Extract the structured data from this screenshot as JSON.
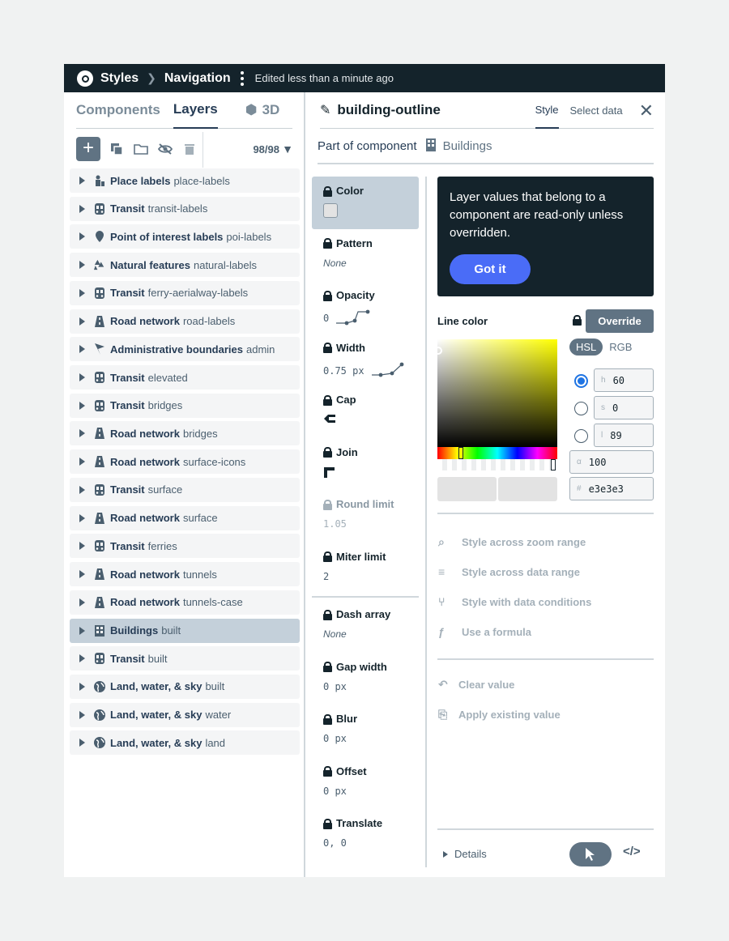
{
  "header": {
    "breadcrumb": [
      "Styles",
      "Navigation"
    ],
    "edited": "Edited less than a minute ago"
  },
  "left_panel": {
    "tabs": [
      "Components",
      "Layers",
      "3D"
    ],
    "layer_count": "98/98",
    "layers": [
      {
        "name": "Place labels",
        "id": "place-labels",
        "icon": "person-icon"
      },
      {
        "name": "Transit",
        "id": "transit-labels",
        "icon": "train-icon"
      },
      {
        "name": "Point of interest labels",
        "id": "poi-labels",
        "icon": "pin-icon"
      },
      {
        "name": "Natural features",
        "id": "natural-labels",
        "icon": "tree-icon"
      },
      {
        "name": "Transit",
        "id": "ferry-aerialway-labels",
        "icon": "train-icon"
      },
      {
        "name": "Road network",
        "id": "road-labels",
        "icon": "road-icon"
      },
      {
        "name": "Administrative boundaries",
        "id": "admin",
        "icon": "flag-icon"
      },
      {
        "name": "Transit",
        "id": "elevated",
        "icon": "train-icon"
      },
      {
        "name": "Transit",
        "id": "bridges",
        "icon": "train-icon"
      },
      {
        "name": "Road network",
        "id": "bridges",
        "icon": "road-icon"
      },
      {
        "name": "Road network",
        "id": "surface-icons",
        "icon": "road-icon"
      },
      {
        "name": "Transit",
        "id": "surface",
        "icon": "train-icon"
      },
      {
        "name": "Road network",
        "id": "surface",
        "icon": "road-icon"
      },
      {
        "name": "Transit",
        "id": "ferries",
        "icon": "train-icon"
      },
      {
        "name": "Road network",
        "id": "tunnels",
        "icon": "road-icon"
      },
      {
        "name": "Road network",
        "id": "tunnels-case",
        "icon": "road-icon"
      },
      {
        "name": "Buildings",
        "id": "built",
        "icon": "building-icon",
        "selected": true
      },
      {
        "name": "Transit",
        "id": "built",
        "icon": "train-icon"
      },
      {
        "name": "Land, water, & sky",
        "id": "built",
        "icon": "globe-icon"
      },
      {
        "name": "Land, water, & sky",
        "id": "water",
        "icon": "globe-icon"
      },
      {
        "name": "Land, water, & sky",
        "id": "land",
        "icon": "globe-icon"
      }
    ]
  },
  "layer_header": {
    "name": "building-outline",
    "tabs": [
      "Style",
      "Select data"
    ],
    "part_of_label": "Part of component",
    "component": "Buildings"
  },
  "properties": [
    {
      "label": "Color",
      "value": "",
      "kind": "swatch",
      "selected": true
    },
    {
      "label": "Pattern",
      "value": "None",
      "kind": "italic"
    },
    {
      "label": "Opacity",
      "value": "0",
      "kind": "curve"
    },
    {
      "label": "Width",
      "value": "0.75 px",
      "kind": "curve"
    },
    {
      "label": "Cap",
      "value": "",
      "kind": "cap"
    },
    {
      "label": "Join",
      "value": "",
      "kind": "join"
    },
    {
      "label": "Round limit",
      "value": "1.05",
      "kind": "muted"
    },
    {
      "label": "Miter limit",
      "value": "2",
      "kind": "mono"
    },
    {
      "label": "Dash array",
      "value": "None",
      "kind": "italic"
    },
    {
      "label": "Gap width",
      "value": "0 px",
      "kind": "mono"
    },
    {
      "label": "Blur",
      "value": "0 px",
      "kind": "mono"
    },
    {
      "label": "Offset",
      "value": "0 px",
      "kind": "mono"
    },
    {
      "label": "Translate",
      "value": "0, 0",
      "kind": "mono"
    }
  ],
  "tooltip": {
    "text": "Layer values that belong to a component are read-only unless overridden.",
    "button": "Got it"
  },
  "color_editor": {
    "label": "Line color",
    "override": "Override",
    "modes": [
      "HSL",
      "RGB"
    ],
    "fields": [
      {
        "label": "h",
        "value": "60"
      },
      {
        "label": "s",
        "value": "0"
      },
      {
        "label": "l",
        "value": "89"
      },
      {
        "label": "α",
        "value": "100"
      },
      {
        "label": "#",
        "value": "e3e3e3"
      }
    ],
    "color": "#e3e3e3"
  },
  "actions": [
    "Style across zoom range",
    "Style across data range",
    "Style with data conditions",
    "Use a formula"
  ],
  "value_actions": [
    "Clear value",
    "Apply existing value"
  ],
  "footer": {
    "details": "Details"
  }
}
